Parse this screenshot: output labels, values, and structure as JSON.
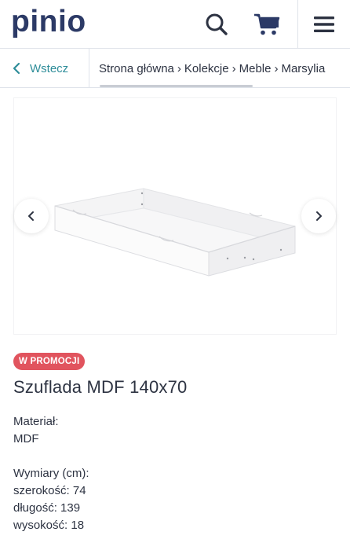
{
  "header": {
    "logo": "pinio",
    "brand_color": "#2c3a66"
  },
  "breadcrumb": {
    "back_label": "Wstecz",
    "items": [
      "Strona główna",
      "Kolekcje",
      "Meble",
      "Marsylia"
    ]
  },
  "product": {
    "badge": "W PROMOCJI",
    "title": "Szuflada MDF 140x70",
    "material_label": "Materiał:",
    "material_value": "MDF",
    "dimensions_label": "Wymiary (cm):",
    "width": "szerokość: 74",
    "length": "długość: 139",
    "height": "wysokość: 18"
  },
  "icons": {
    "search": "search-icon",
    "cart": "cart-icon",
    "menu": "hamburger-menu-icon",
    "back": "chevron-left-icon",
    "prev": "chevron-left-icon",
    "next": "chevron-right-icon"
  },
  "colors": {
    "accent": "#2e8d99",
    "badge": "#e1545e",
    "text": "#2d3342"
  }
}
